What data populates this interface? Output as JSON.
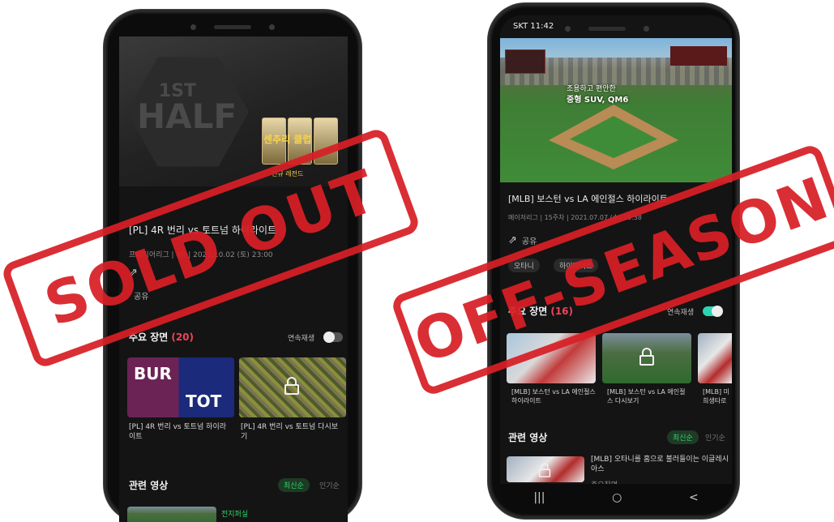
{
  "phone_left": {
    "hero": {
      "line1": "1ST",
      "line2": "HALF",
      "banner": "센추리 클럽",
      "banner_sub": "신규 레전드"
    },
    "video_title": "[PL] 4R 번리 vs 토트넘 하이라이트",
    "meta": "프리미어리그 | 4R | 2021.10.02 (토) 23:00",
    "share_label": "공유",
    "highlights": {
      "title": "주요 장면",
      "count": "(20)",
      "autoplay_label": "연속재생"
    },
    "clips": [
      {
        "caption": "[PL] 4R 번리 vs 토트넘 하이라이트",
        "thumb_text_left": "BUR",
        "thumb_text_right": "TOT",
        "locked": false
      },
      {
        "caption": "[PL] 4R 번리 vs 토트넘 다시보기",
        "locked": true
      }
    ],
    "related": {
      "title": "관련 영상",
      "sort_active": "최신순",
      "sort_idle": "인기순",
      "first_item_sub": "전지퍼실"
    }
  },
  "phone_right": {
    "status_time": "SKT 11:42",
    "ad_line1": "조용하고 편안한",
    "ad_line2": "중형 SUV, QM6",
    "video_title": "[MLB] 보스턴 vs LA 에인절스 하이라이트",
    "meta": "메이저리그 | 15주차 | 2021.07.07 (수) 10:38",
    "share_label": "공유",
    "tags": [
      "오타니",
      "하이라이트"
    ],
    "highlights": {
      "title": "주요 장면",
      "count": "(16)",
      "autoplay_label": "연속재생"
    },
    "clips": [
      {
        "caption": "[MLB] 보스턴 vs LA 에인절스 하이라이트",
        "locked": false
      },
      {
        "caption": "[MLB] 보스턴 vs LA 에인절스 다시보기",
        "locked": true
      },
      {
        "caption": "[MLB] 미 희생타로",
        "locked": false
      }
    ],
    "related": {
      "title": "관련 영상",
      "sort_active": "최신순",
      "sort_idle": "인기순",
      "first_item_title": "[MLB] 오타니를 홈으로 불러들이는 이글레시아스",
      "first_item_sub": "주요장면"
    },
    "nav": {
      "recent": "|||",
      "home": "○",
      "back": "<"
    }
  },
  "stamps": {
    "left": "SOLD OUT",
    "right": "OFF-SEASON"
  },
  "colors": {
    "stamp_red": "#d81f26",
    "count_pink": "#f0435a",
    "toggle_on": "#2dd4b4",
    "sort_green": "#2fd36a"
  }
}
